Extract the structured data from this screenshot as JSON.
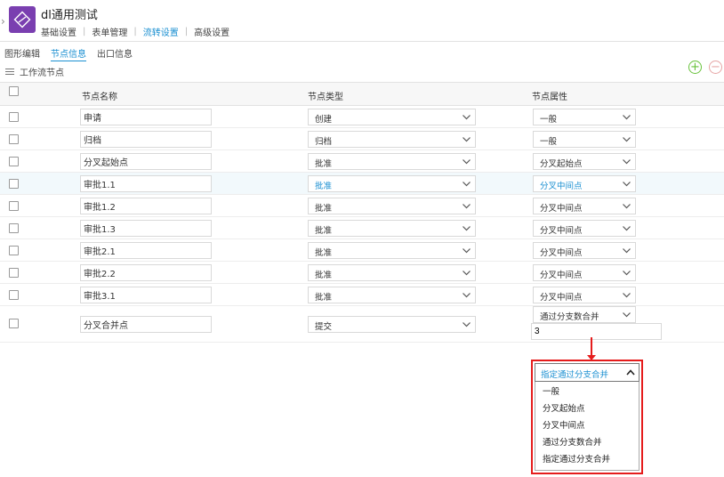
{
  "app": {
    "title": "dl通用测试"
  },
  "top_nav": {
    "items": [
      "基础设置",
      "表单管理",
      "流转设置",
      "高级设置"
    ]
  },
  "sub_tabs": [
    "图形编辑",
    "节点信息",
    "出口信息"
  ],
  "section": {
    "title": "工作流节点",
    "add_label": "+",
    "remove_label": "−"
  },
  "grid": {
    "headers": [
      "节点名称",
      "节点类型",
      "节点属性"
    ],
    "rows": [
      {
        "name": "申请",
        "type": "创建",
        "attr": "一般"
      },
      {
        "name": "归档",
        "type": "归档",
        "attr": "一般"
      },
      {
        "name": "分叉起始点",
        "type": "批准",
        "attr": "分叉起始点"
      },
      {
        "name": "审批1.1",
        "type": "批准",
        "attr": "分叉中间点"
      },
      {
        "name": "审批1.2",
        "type": "批准",
        "attr": "分叉中间点"
      },
      {
        "name": "审批1.3",
        "type": "批准",
        "attr": "分叉中间点"
      },
      {
        "name": "审批2.1",
        "type": "批准",
        "attr": "分叉中间点"
      },
      {
        "name": "审批2.2",
        "type": "批准",
        "attr": "分叉中间点"
      },
      {
        "name": "审批3.1",
        "type": "批准",
        "attr": "分叉中间点"
      },
      {
        "name": "分叉合并点",
        "type": "提交",
        "attr": "通过分支数合并",
        "count": "3"
      }
    ]
  },
  "dropdown": {
    "selected": "指定通过分支合并",
    "options": [
      "一般",
      "分叉起始点",
      "分叉中间点",
      "通过分支数合并",
      "指定通过分支合并"
    ]
  },
  "colors": {
    "accent": "#1a8fd1",
    "app_icon": "#7a3fb0",
    "highlight": "#e51c1c",
    "add": "#67c23a"
  }
}
